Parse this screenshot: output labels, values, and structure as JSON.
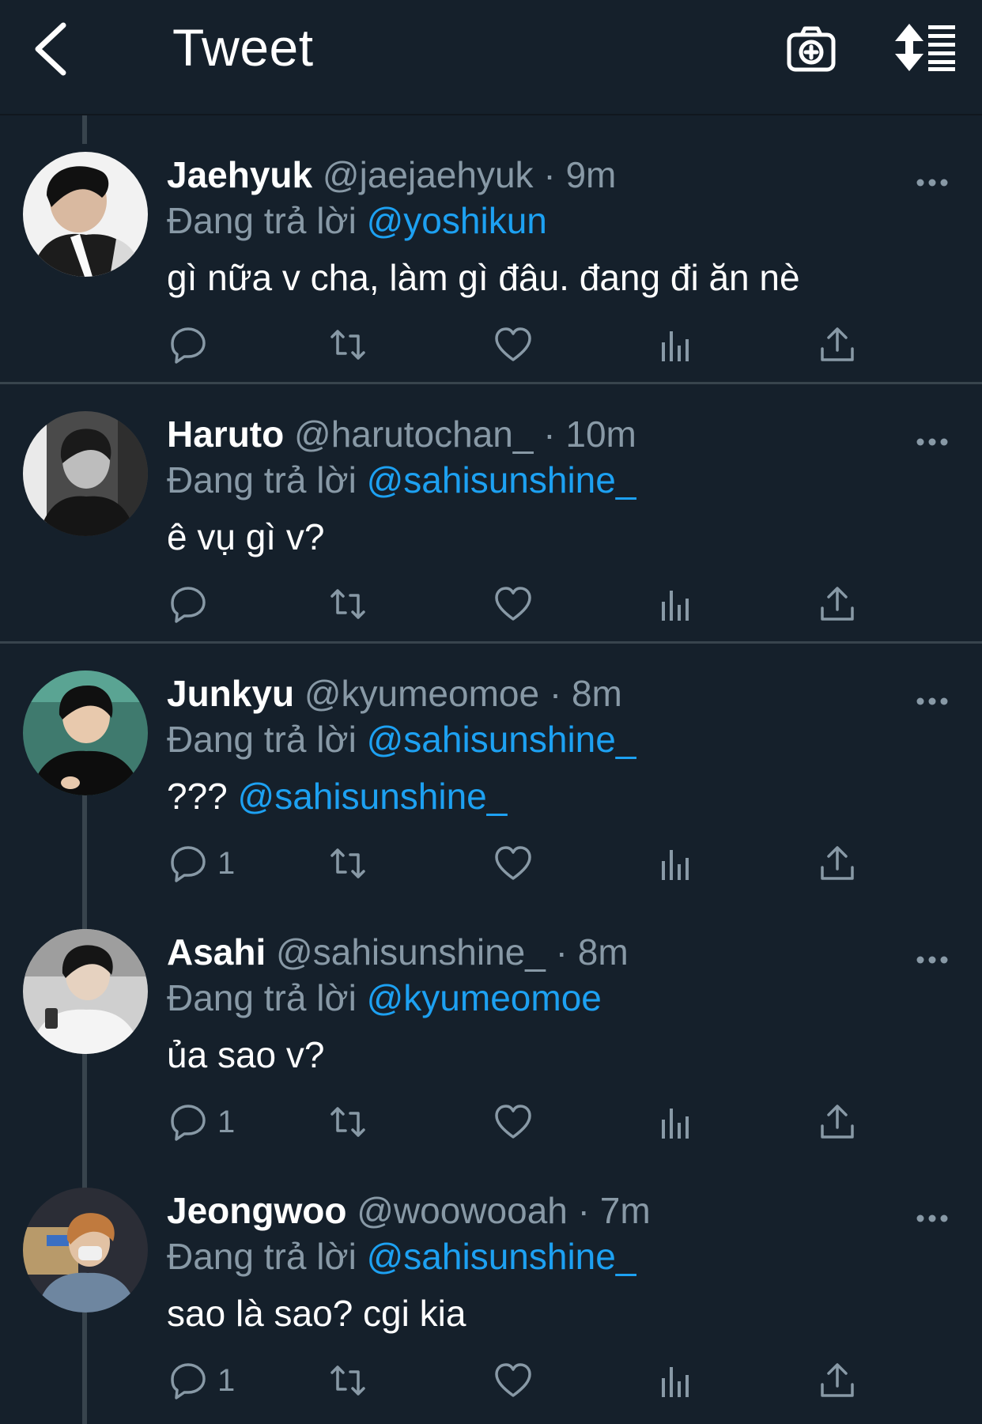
{
  "header": {
    "title": "Tweet",
    "back_icon": "chevron-left-icon",
    "camera_icon": "camera-add-icon",
    "sort_icon": "sort-replies-icon"
  },
  "colors": {
    "background": "#15202b",
    "accent": "#1da1f2",
    "muted": "#8899a6",
    "divider": "#38444d"
  },
  "tweets": [
    {
      "name": "Jaehyuk",
      "handle": "@jaejaehyuk",
      "separator": "·",
      "time": "9m",
      "replying_label": "Đang trả lời",
      "replying_to": "@yoshikun",
      "text": "gì nữa v cha, làm gì đâu. đang đi ăn nè",
      "text_mention": "",
      "reply_count": ""
    },
    {
      "name": "Haruto",
      "handle": "@harutochan_",
      "separator": "·",
      "time": "10m",
      "replying_label": "Đang trả lời",
      "replying_to": "@sahisunshine_",
      "text": "ê vụ gì v?",
      "text_mention": "",
      "reply_count": ""
    },
    {
      "name": "Junkyu",
      "handle": "@kyumeomoe",
      "separator": "·",
      "time": "8m",
      "replying_label": "Đang trả lời",
      "replying_to": "@sahisunshine_",
      "text": "??? ",
      "text_mention": "@sahisunshine_",
      "reply_count": "1"
    },
    {
      "name": "Asahi",
      "handle": "@sahisunshine_",
      "separator": "·",
      "time": "8m",
      "replying_label": "Đang trả lời",
      "replying_to": "@kyumeomoe",
      "text": "ủa sao v?",
      "text_mention": "",
      "reply_count": "1"
    },
    {
      "name": "Jeongwoo",
      "handle": "@woowooah",
      "separator": "·",
      "time": "7m",
      "replying_label": "Đang trả lời",
      "replying_to": "@sahisunshine_",
      "text": "sao là sao? cgi kia",
      "text_mention": "",
      "reply_count": "1"
    }
  ]
}
